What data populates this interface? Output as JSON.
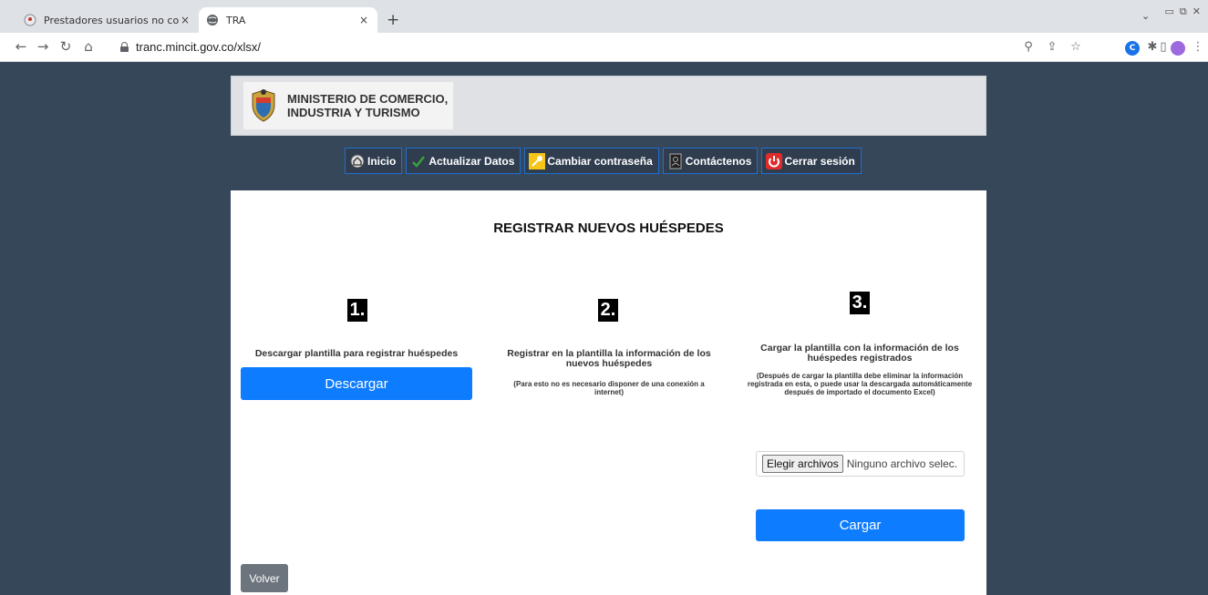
{
  "browser": {
    "tabs": [
      {
        "title": "Prestadores usuarios no conecta",
        "active": false
      },
      {
        "title": "TRA",
        "active": true
      }
    ],
    "new_tab_symbol": "+",
    "close_symbol": "×",
    "url": "tranc.mincit.gov.co/xlsx/",
    "icons": [
      "back-icon",
      "forward-icon",
      "reload-icon",
      "home-icon",
      "lock-icon",
      "zoom-icon",
      "share-icon",
      "star-icon",
      "extension-icon",
      "puzzle-icon",
      "sidepanel-icon",
      "profile-icon",
      "menu-icon"
    ]
  },
  "header": {
    "ministry_line1": "MINISTERIO DE COMERCIO,",
    "ministry_line2": "INDUSTRIA Y TURISMO"
  },
  "nav": {
    "items": [
      {
        "label": "Inicio",
        "icon": "home-icon"
      },
      {
        "label": "Actualizar Datos",
        "icon": "check-icon"
      },
      {
        "label": "Cambiar contraseña",
        "icon": "key-icon"
      },
      {
        "label": "Contáctenos",
        "icon": "contact-icon"
      },
      {
        "label": "Cerrar sesión",
        "icon": "power-icon"
      }
    ]
  },
  "main": {
    "title": "REGISTRAR NUEVOS HUÉSPEDES",
    "steps": [
      {
        "num": "1.",
        "title": "Descargar plantilla para registrar huéspedes",
        "button": "Descargar"
      },
      {
        "num": "2.",
        "title": "Registrar en la plantilla la información de los nuevos huéspedes",
        "note": "(Para esto no es necesario disponer de una conexión a internet)"
      },
      {
        "num": "3.",
        "title": "Cargar la plantilla con la información de los huéspedes registrados",
        "note": "(Después de cargar la plantilla debe eliminar la información registrada en esta, o puede usar la descargada automáticamente después de importado el documento Excel)",
        "file_button": "Elegir archivos",
        "file_status": "Ninguno archivo selec.",
        "button": "Cargar"
      }
    ],
    "back_button": "Volver"
  },
  "colors": {
    "page_bg": "#37475a",
    "primary_button": "#0d7cff",
    "nav_bg": "#2f3d4e",
    "back_button": "#6c757d"
  }
}
